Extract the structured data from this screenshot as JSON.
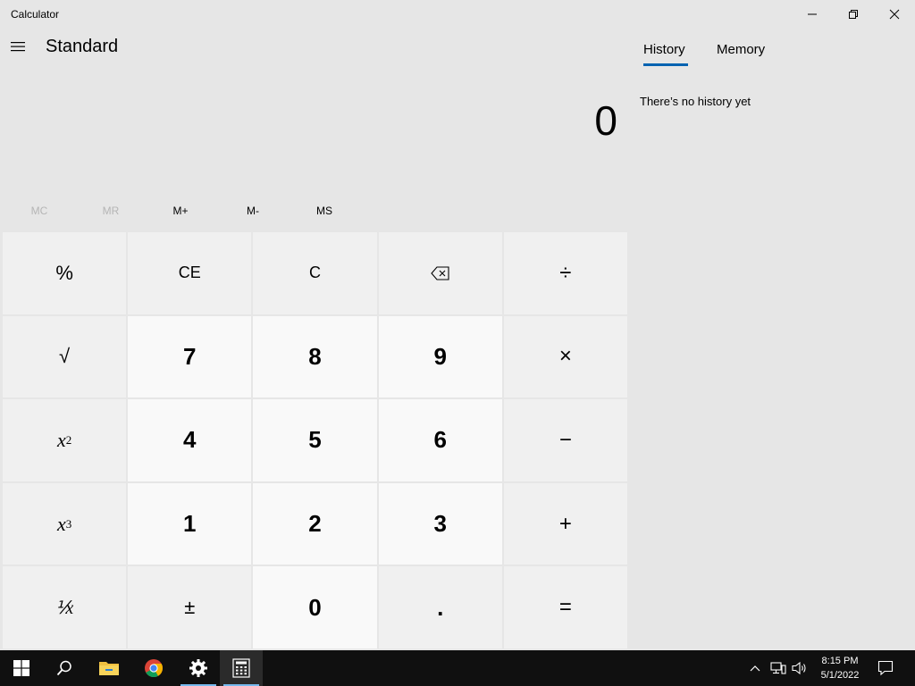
{
  "window": {
    "title": "Calculator",
    "controls": {
      "minimize": "minimize",
      "restore": "restore",
      "close": "close"
    }
  },
  "header": {
    "mode": "Standard"
  },
  "display": {
    "value": "0"
  },
  "memory": {
    "mc": "MC",
    "mr": "MR",
    "mplus": "M+",
    "mminus": "M-",
    "ms": "MS"
  },
  "keys": {
    "percent": "%",
    "ce": "CE",
    "clear": "C",
    "sqrt": "√",
    "seven": "7",
    "eight": "8",
    "nine": "9",
    "x_var": "x",
    "square_exp": "2",
    "cube_exp": "3",
    "four": "4",
    "five": "5",
    "six": "6",
    "one": "1",
    "two": "2",
    "three": "3",
    "reciprocal": "⅟x",
    "negate": "±",
    "zero": "0",
    "decimal": ".",
    "divide": "÷",
    "multiply": "×",
    "minus": "−",
    "plus": "+",
    "equals": "="
  },
  "side_pane": {
    "tab_history": "History",
    "tab_memory": "Memory",
    "history_empty": "There’s no history yet"
  },
  "taskbar": {
    "time": "8:15 PM",
    "date": "5/1/2022",
    "accent_color": "#76b9ed"
  },
  "colors": {
    "background": "#e6e6e6",
    "accent": "#0063b1",
    "number_key": "#f9f9f9",
    "function_key": "#f0f0f0"
  }
}
